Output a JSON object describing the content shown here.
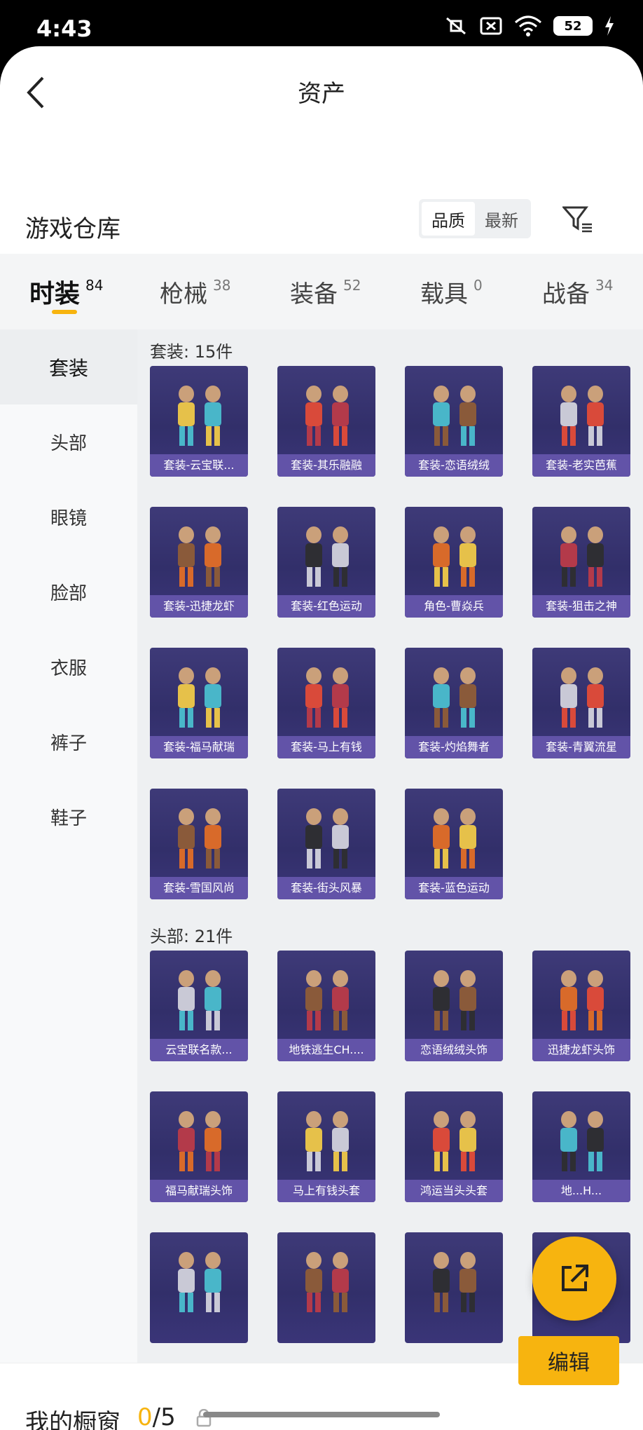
{
  "status": {
    "time": "4:43",
    "battery": "52"
  },
  "header": {
    "title": "资产"
  },
  "warehouse": {
    "title": "游戏仓库",
    "sort": [
      "品质",
      "最新"
    ]
  },
  "tabs": [
    {
      "label": "时装",
      "count": "84"
    },
    {
      "label": "枪械",
      "count": "38"
    },
    {
      "label": "装备",
      "count": "52"
    },
    {
      "label": "载具",
      "count": "0"
    },
    {
      "label": "战备",
      "count": "34"
    }
  ],
  "sidebar": [
    "套装",
    "头部",
    "眼镜",
    "脸部",
    "衣服",
    "裤子",
    "鞋子"
  ],
  "sections": [
    {
      "title": "套装: 15件",
      "items": [
        "套装-云宝联...",
        "套装-其乐融融",
        "套装-恋语绒绒",
        "套装-老实芭蕉",
        "套装-迅捷龙虾",
        "套装-红色运动",
        "角色-曹焱兵",
        "套装-狙击之神",
        "套装-福马献瑞",
        "套装-马上有钱",
        "套装-灼焰舞者",
        "套装-青翼流星",
        "套装-雪国风尚",
        "套装-街头风暴",
        "套装-蓝色运动"
      ]
    },
    {
      "title": "头部: 21件",
      "items": [
        "云宝联名款...",
        "地铁逃生CH....",
        "恋语绒绒头饰",
        "迅捷龙虾头饰",
        "福马献瑞头饰",
        "马上有钱头套",
        "鸿运当头头套",
        "地...H...",
        "",
        "",
        "",
        ""
      ]
    }
  ],
  "bottom": {
    "label": "我的橱窗",
    "used": "0",
    "total": "/5",
    "edit": "编辑"
  },
  "colors": {
    "accent": "#f7b40f",
    "card_bg": "#3a3574",
    "card_label": "#6253a8"
  }
}
